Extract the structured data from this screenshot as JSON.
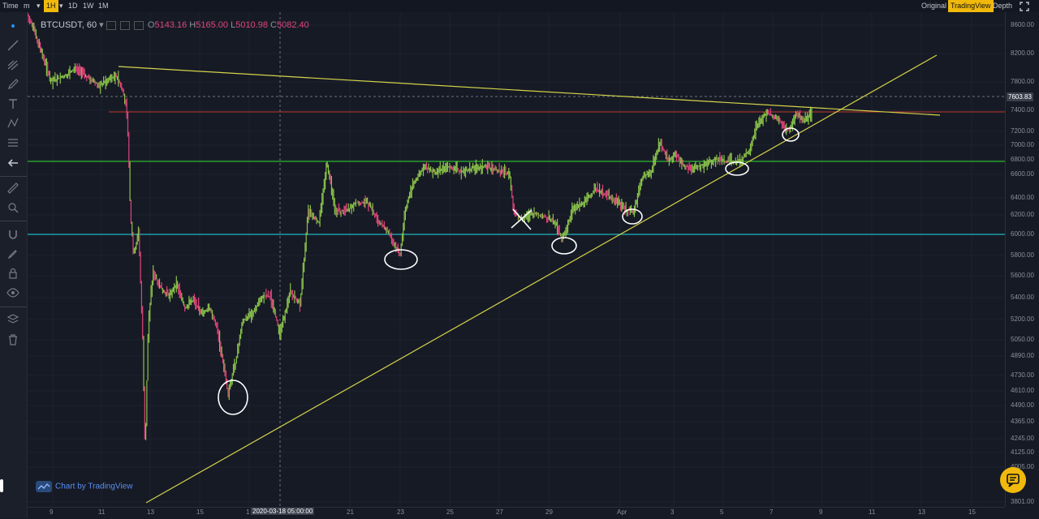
{
  "topbar": {
    "items_left": [
      "Time",
      "m",
      "1H",
      "1D",
      "1W",
      "1M"
    ],
    "active_interval": "1H",
    "items_right": [
      "Original",
      "TradingView",
      "Depth"
    ],
    "active_view": "TradingView"
  },
  "legend": {
    "symbol": "BTCUSDT, 60",
    "open_label": "O",
    "open": "5143.16",
    "high_label": "H",
    "high": "5165.00",
    "low_label": "L",
    "low": "5010.98",
    "close_label": "C",
    "close": "5082.40"
  },
  "y_axis_labels": [
    "8600.00",
    "8200.00",
    "7800.00",
    "7400.00",
    "7200.00",
    "7000.00",
    "6800.00",
    "6600.00",
    "6400.00",
    "6200.00",
    "6000.00",
    "5800.00",
    "5600.00",
    "5400.00",
    "5200.00",
    "5050.00",
    "4890.00",
    "4730.00",
    "4610.00",
    "4490.00",
    "4365.00",
    "4245.00",
    "4125.00",
    "4005.00",
    "3801.00"
  ],
  "current_price": "7603.83",
  "x_axis_labels": [
    "9",
    "11",
    "13",
    "15",
    "1",
    "21",
    "23",
    "25",
    "27",
    "29",
    "Apr",
    "3",
    "5",
    "7",
    "9",
    "11",
    "13",
    "15"
  ],
  "crosshair_date": "2020-03-18 05:00:00",
  "watermark": "Chart by TradingView",
  "colors": {
    "background": "#161a25",
    "up_candle": "#8bc34a",
    "down_candle": "#e0457b",
    "trendline": "#d4d44a",
    "resistance_red": "#c0392b",
    "support_green": "#2eb82e",
    "support_cyan": "#1fb6c1",
    "accent": "#f0b90b"
  },
  "icons": [
    "pointer-icon",
    "trendline-icon",
    "brush-icon",
    "pen-icon",
    "text-icon",
    "pattern-icon",
    "projection-icon",
    "back-arrow-icon",
    "ruler-icon",
    "zoom-icon",
    "magnet-icon",
    "lock-icon",
    "unlock-icon",
    "eye-icon",
    "layers-icon",
    "trash-icon",
    "chat-icon",
    "fullscreen-icon"
  ]
}
